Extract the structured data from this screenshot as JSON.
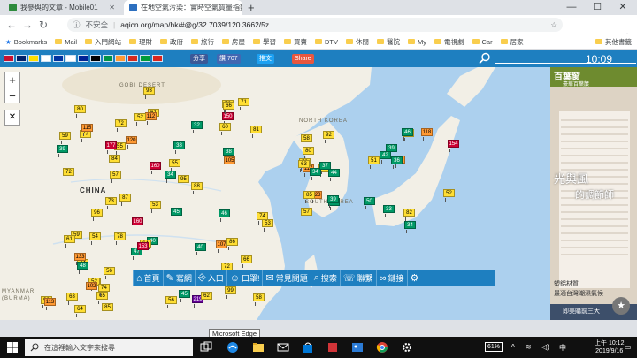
{
  "browser": {
    "tabs": [
      {
        "title": "我參與的文章 - Mobile01",
        "fav": "#2e8b3d"
      },
      {
        "title": "在地空氣污染：實時空氣質量指數",
        "fav": "#2c6fbf"
      }
    ],
    "window_controls": [
      "—",
      "☐",
      "✕"
    ],
    "url_security": "不安全",
    "url": "aqicn.org/map/hk/#@g/32.7039/120.3662/5z",
    "bookmarks": [
      "Bookmarks",
      "Mail",
      "入門網站",
      "理財",
      "政府",
      "旅行",
      "房屋",
      "學習",
      "買賣",
      "DTV",
      "休閒",
      "醫院",
      "My",
      "電視劇",
      "Car",
      "居家"
    ],
    "other_bookmarks": "其他書籤"
  },
  "site": {
    "share_labels": [
      "分享",
      "讚 707",
      "推文",
      "Share"
    ],
    "share_colors": [
      "#3b5998",
      "#4267b2",
      "#1da1f2",
      "#e8573f"
    ],
    "flag_colors": [
      "#c8102e",
      "#012169",
      "#ffde00",
      "#ffffff",
      "#0033a0",
      "#ffffff",
      "#002395",
      "#000000",
      "#009246",
      "#ff9933",
      "#d52b1e",
      "#009c3b",
      "#da251d"
    ],
    "time": "10:09",
    "bottom_nav": [
      {
        "icon": "home-icon",
        "label": "首頁"
      },
      {
        "icon": "edit-icon",
        "label": "寫網"
      },
      {
        "icon": "door-icon",
        "label": "入口"
      },
      {
        "icon": "mask-icon",
        "label": "口罩!"
      },
      {
        "icon": "chat-icon",
        "label": "常見問題"
      },
      {
        "icon": "search-icon",
        "label": "搜索"
      },
      {
        "icon": "phone-icon",
        "label": "聯繫"
      },
      {
        "icon": "link-icon",
        "label": "鏈接"
      },
      {
        "icon": "gear-icon",
        "label": ""
      }
    ],
    "tooltip": "Microsoft Edge"
  },
  "map": {
    "labels": [
      "GOBI DESERT",
      "CHINA",
      "NORTH KOREA",
      "SOUTH KOREA",
      "MYANMAR (BURMA)"
    ],
    "zoom_in": "+",
    "zoom_out": "−",
    "markers": [
      {
        "v": "55",
        "c": "#ffde33"
      },
      {
        "v": "61",
        "c": "#ffde33"
      },
      {
        "v": "107",
        "c": "#ff9933"
      },
      {
        "v": "65",
        "c": "#ffde33"
      },
      {
        "v": "74",
        "c": "#ffde33"
      },
      {
        "v": "123",
        "c": "#ff9933"
      },
      {
        "v": "118",
        "c": "#ff9933"
      },
      {
        "v": "72",
        "c": "#ffde33"
      },
      {
        "v": "76",
        "c": "#ffde33"
      },
      {
        "v": "86",
        "c": "#ffde33"
      },
      {
        "v": "73",
        "c": "#ffde33"
      },
      {
        "v": "85",
        "c": "#ffde33"
      },
      {
        "v": "117",
        "c": "#ff9933"
      },
      {
        "v": "154",
        "c": "#cc0033"
      },
      {
        "v": "177",
        "c": "#cc0033"
      },
      {
        "v": "150",
        "c": "#cc0033"
      },
      {
        "v": "219",
        "c": "#660099"
      },
      {
        "v": "160",
        "c": "#cc0033"
      },
      {
        "v": "133",
        "c": "#ff9933"
      },
      {
        "v": "85",
        "c": "#ffde33"
      },
      {
        "v": "110",
        "c": "#ff9933"
      },
      {
        "v": "72",
        "c": "#ffde33"
      },
      {
        "v": "34",
        "c": "#009966"
      },
      {
        "v": "46",
        "c": "#009966"
      },
      {
        "v": "40",
        "c": "#009966"
      },
      {
        "v": "70",
        "c": "#ffde33"
      },
      {
        "v": "80",
        "c": "#ffde33"
      },
      {
        "v": "66",
        "c": "#ffde33"
      },
      {
        "v": "59",
        "c": "#ffde33"
      },
      {
        "v": "38",
        "c": "#009966"
      },
      {
        "v": "53",
        "c": "#ffde33"
      },
      {
        "v": "47",
        "c": "#009966"
      },
      {
        "v": "63",
        "c": "#ffde33"
      },
      {
        "v": "68",
        "c": "#ffde33"
      },
      {
        "v": "39",
        "c": "#009966"
      },
      {
        "v": "112",
        "c": "#ff9933"
      },
      {
        "v": "55",
        "c": "#ffde33"
      },
      {
        "v": "58",
        "c": "#ffde33"
      },
      {
        "v": "45",
        "c": "#009966"
      },
      {
        "v": "52",
        "c": "#ffde33"
      },
      {
        "v": "92",
        "c": "#ffde33"
      },
      {
        "v": "36",
        "c": "#009966"
      },
      {
        "v": "77",
        "c": "#ffde33"
      },
      {
        "v": "105",
        "c": "#ff9933"
      },
      {
        "v": "62",
        "c": "#ffde33"
      },
      {
        "v": "54",
        "c": "#ffde33"
      },
      {
        "v": "48",
        "c": "#009966"
      },
      {
        "v": "57",
        "c": "#ffde33"
      },
      {
        "v": "82",
        "c": "#ffde33"
      },
      {
        "v": "120",
        "c": "#ff9933"
      },
      {
        "v": "160",
        "c": "#cc0033"
      },
      {
        "v": "74",
        "c": "#ffde33"
      },
      {
        "v": "96",
        "c": "#ffde33"
      },
      {
        "v": "102",
        "c": "#ff9933"
      },
      {
        "v": "43",
        "c": "#009966"
      },
      {
        "v": "33",
        "c": "#009966"
      },
      {
        "v": "80",
        "c": "#ffde33"
      },
      {
        "v": "93",
        "c": "#ffde33"
      },
      {
        "v": "62",
        "c": "#ffde33"
      },
      {
        "v": "45",
        "c": "#009966"
      },
      {
        "v": "59",
        "c": "#ffde33"
      },
      {
        "v": "34",
        "c": "#009966"
      },
      {
        "v": "51",
        "c": "#ffde33"
      },
      {
        "v": "115",
        "c": "#ff9933"
      },
      {
        "v": "71",
        "c": "#ffde33"
      },
      {
        "v": "88",
        "c": "#ffde33"
      },
      {
        "v": "53",
        "c": "#ffde33"
      },
      {
        "v": "61",
        "c": "#ffde33"
      },
      {
        "v": "37",
        "c": "#009966"
      },
      {
        "v": "50",
        "c": "#009966"
      },
      {
        "v": "84",
        "c": "#ffde33"
      },
      {
        "v": "95",
        "c": "#ffde33"
      },
      {
        "v": "66",
        "c": "#ffde33"
      },
      {
        "v": "78",
        "c": "#ffde33"
      },
      {
        "v": "90",
        "c": "#ffde33"
      },
      {
        "v": "58",
        "c": "#ffde33"
      },
      {
        "v": "42",
        "c": "#009966"
      },
      {
        "v": "39",
        "c": "#009966"
      },
      {
        "v": "32",
        "c": "#009966"
      },
      {
        "v": "99",
        "c": "#ffde33"
      },
      {
        "v": "64",
        "c": "#ffde33"
      },
      {
        "v": "113",
        "c": "#ff9933"
      },
      {
        "v": "44",
        "c": "#009966"
      },
      {
        "v": "52",
        "c": "#ffde33"
      },
      {
        "v": "57",
        "c": "#ffde33"
      },
      {
        "v": "81",
        "c": "#ffde33"
      },
      {
        "v": "72",
        "c": "#ffde33"
      },
      {
        "v": "56",
        "c": "#ffde33"
      },
      {
        "v": "64",
        "c": "#ffde33"
      },
      {
        "v": "39",
        "c": "#009966"
      },
      {
        "v": "46",
        "c": "#009966"
      },
      {
        "v": "38",
        "c": "#009966"
      },
      {
        "v": "60",
        "c": "#ffde33"
      },
      {
        "v": "53",
        "c": "#ffde33"
      },
      {
        "v": "153",
        "c": "#cc0033"
      },
      {
        "v": "74",
        "c": "#ffde33"
      },
      {
        "v": "59",
        "c": "#ffde33"
      },
      {
        "v": "34",
        "c": "#009966"
      },
      {
        "v": "52",
        "c": "#ffde33"
      },
      {
        "v": "66",
        "c": "#ffde33"
      },
      {
        "v": "40",
        "c": "#009966"
      },
      {
        "v": "87",
        "c": "#ffde33"
      },
      {
        "v": "56",
        "c": "#ffde33"
      },
      {
        "v": "63",
        "c": "#ffde33"
      }
    ]
  },
  "ad": {
    "brand": "百葉窗",
    "brand_sub": "豪華百葉簾",
    "headline_1": "光與風",
    "headline_2": "的調節師",
    "body_1": "塑鋁材質",
    "body_2": "最適台灣潮濕氣候",
    "cta": "即美購前三大"
  },
  "taskbar": {
    "search_placeholder": "在這裡輸入文字來搜尋",
    "battery": "61%",
    "time": "上午 10:12",
    "date": "2019/9/16"
  }
}
